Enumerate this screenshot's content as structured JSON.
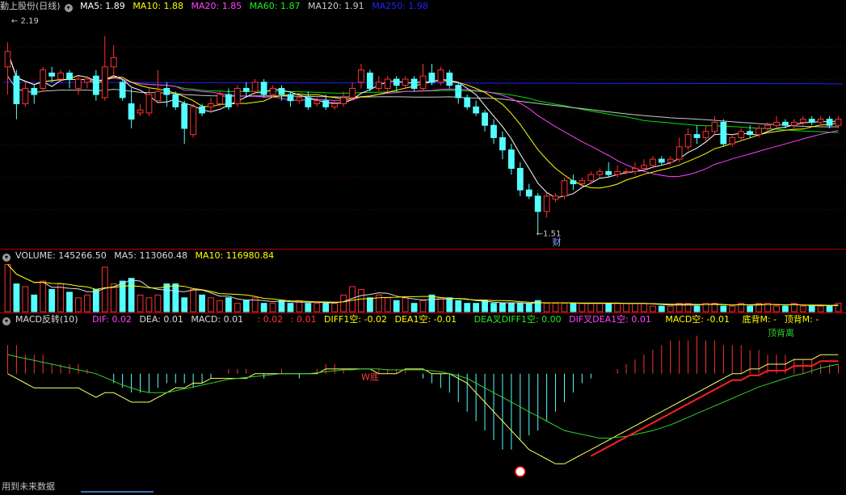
{
  "colors": {
    "bg": "#000000",
    "up": "#ff3232",
    "down": "#54ffff",
    "grid": "#3a0000",
    "sep": "#b00000",
    "ma5": "#ffffff",
    "ma10": "#ffff00",
    "ma20": "#ff40ff",
    "ma60": "#00e000",
    "ma120": "#c8c8c8",
    "ma250": "#2020ff"
  },
  "header_price": {
    "title": "勤上股份(日线)",
    "ma5": "MA5: 1.89",
    "ma10": "MA10: 1.88",
    "ma20": "MA20: 1.85",
    "ma60": "MA60: 1.87",
    "ma120": "MA120: 1.91",
    "ma250": "MA250: 1.98"
  },
  "header_vol": {
    "title": "VOLUME: 145266.50",
    "ma5": "MA5: 113060.48",
    "ma10": "MA10: 116980.84"
  },
  "header_macd": {
    "title": "MACD反转(10)",
    "dif": "DIF: 0.02",
    "dea": "DEA: 0.01",
    "macd": "MACD: 0.01",
    "f1": ": 0.02",
    "f2": ": 0.01",
    "diff1": "DIFF1空: -0.02",
    "dea1": "DEA1空: -0.01",
    "cross1": "DEA叉DIFF1空: 0.00",
    "cross2": "DIF叉DEA1空: 0.01",
    "macd_short": "MACD空: -0.01",
    "bottom": "底背M: -",
    "top": "顶背M: -"
  },
  "footer": {
    "text": "用到未来数据"
  },
  "chart_data": {
    "type": "candlestick",
    "annotations": {
      "high": "2.19",
      "low": "1.51",
      "fin": "财",
      "pattern_w": "W底",
      "top_div": "顶背离"
    },
    "candles": [
      [
        2.05,
        2.1,
        1.96,
        2.13
      ],
      [
        2.02,
        1.93,
        1.88,
        2.04
      ],
      [
        1.93,
        1.98,
        1.92,
        2.0
      ],
      [
        1.98,
        1.96,
        1.93,
        1.99
      ],
      [
        1.98,
        2.04,
        1.97,
        2.05
      ],
      [
        2.03,
        2.02,
        2.0,
        2.05
      ],
      [
        2.01,
        2.03,
        2.0,
        2.04
      ],
      [
        2.03,
        2.01,
        1.98,
        2.04
      ],
      [
        1.98,
        2.01,
        1.96,
        2.02
      ],
      [
        2.0,
        2.01,
        1.98,
        2.02
      ],
      [
        2.02,
        1.96,
        1.94,
        2.04
      ],
      [
        1.95,
        2.05,
        1.94,
        2.15
      ],
      [
        2.05,
        2.08,
        2.02,
        2.12
      ],
      [
        2.0,
        1.95,
        1.94,
        2.01
      ],
      [
        1.93,
        1.88,
        1.85,
        1.98
      ],
      [
        1.9,
        1.91,
        1.89,
        1.93
      ],
      [
        1.9,
        1.96,
        1.89,
        1.98
      ],
      [
        1.94,
        1.97,
        1.94,
        2.04
      ],
      [
        1.98,
        1.96,
        1.92,
        2.0
      ],
      [
        1.96,
        1.92,
        1.91,
        1.97
      ],
      [
        1.93,
        1.85,
        1.8,
        1.94
      ],
      [
        1.83,
        1.92,
        1.82,
        1.93
      ],
      [
        1.92,
        1.9,
        1.89,
        1.93
      ],
      [
        1.92,
        1.93,
        1.9,
        1.95
      ],
      [
        1.93,
        1.96,
        1.92,
        1.97
      ],
      [
        1.96,
        1.92,
        1.91,
        1.98
      ],
      [
        1.93,
        1.98,
        1.92,
        1.99
      ],
      [
        1.98,
        1.97,
        1.95,
        2.0
      ],
      [
        1.97,
        2.0,
        1.96,
        2.01
      ],
      [
        2.0,
        1.96,
        1.95,
        2.01
      ],
      [
        1.96,
        1.98,
        1.95,
        1.99
      ],
      [
        1.98,
        1.96,
        1.94,
        1.99
      ],
      [
        1.96,
        1.94,
        1.92,
        1.97
      ],
      [
        1.94,
        1.95,
        1.93,
        1.96
      ],
      [
        1.95,
        1.92,
        1.91,
        1.97
      ],
      [
        1.93,
        1.94,
        1.92,
        1.95
      ],
      [
        1.94,
        1.92,
        1.91,
        1.96
      ],
      [
        1.92,
        1.93,
        1.91,
        1.94
      ],
      [
        1.93,
        1.95,
        1.92,
        1.97
      ],
      [
        1.95,
        1.98,
        1.94,
        2.0
      ],
      [
        2.0,
        2.04,
        1.98,
        2.06
      ],
      [
        2.03,
        1.98,
        1.97,
        2.04
      ],
      [
        1.98,
        2.0,
        1.97,
        2.02
      ],
      [
        1.98,
        2.01,
        1.97,
        2.02
      ],
      [
        2.01,
        1.99,
        1.97,
        2.02
      ],
      [
        1.99,
        2.01,
        1.98,
        2.02
      ],
      [
        2.01,
        1.98,
        1.97,
        2.02
      ],
      [
        1.98,
        2.02,
        1.97,
        2.06
      ],
      [
        2.03,
        2.0,
        1.99,
        2.06
      ],
      [
        2.0,
        2.04,
        1.99,
        2.05
      ],
      [
        2.03,
        1.99,
        1.98,
        2.04
      ],
      [
        1.99,
        1.95,
        1.93,
        2.0
      ],
      [
        1.95,
        1.92,
        1.91,
        1.96
      ],
      [
        1.92,
        1.9,
        1.89,
        1.94
      ],
      [
        1.9,
        1.86,
        1.84,
        1.91
      ],
      [
        1.86,
        1.82,
        1.8,
        1.88
      ],
      [
        1.82,
        1.78,
        1.75,
        1.84
      ],
      [
        1.78,
        1.72,
        1.7,
        1.8
      ],
      [
        1.72,
        1.65,
        1.63,
        1.74
      ],
      [
        1.65,
        1.63,
        1.62,
        1.67
      ],
      [
        1.63,
        1.58,
        1.51,
        1.64
      ],
      [
        1.58,
        1.63,
        1.56,
        1.64
      ],
      [
        1.62,
        1.63,
        1.61,
        1.64
      ],
      [
        1.63,
        1.68,
        1.62,
        1.69
      ],
      [
        1.68,
        1.67,
        1.65,
        1.7
      ],
      [
        1.67,
        1.68,
        1.66,
        1.69
      ],
      [
        1.68,
        1.7,
        1.67,
        1.71
      ],
      [
        1.7,
        1.71,
        1.69,
        1.72
      ],
      [
        1.71,
        1.7,
        1.69,
        1.74
      ],
      [
        1.7,
        1.71,
        1.69,
        1.73
      ],
      [
        1.71,
        1.71,
        1.7,
        1.72
      ],
      [
        1.71,
        1.72,
        1.7,
        1.74
      ],
      [
        1.72,
        1.73,
        1.71,
        1.75
      ],
      [
        1.73,
        1.75,
        1.72,
        1.76
      ],
      [
        1.75,
        1.74,
        1.73,
        1.76
      ],
      [
        1.74,
        1.75,
        1.73,
        1.76
      ],
      [
        1.75,
        1.79,
        1.74,
        1.82
      ],
      [
        1.79,
        1.83,
        1.78,
        1.85
      ],
      [
        1.83,
        1.82,
        1.8,
        1.86
      ],
      [
        1.82,
        1.84,
        1.81,
        1.86
      ],
      [
        1.84,
        1.87,
        1.83,
        1.89
      ],
      [
        1.87,
        1.8,
        1.79,
        1.88
      ],
      [
        1.8,
        1.82,
        1.79,
        1.83
      ],
      [
        1.82,
        1.84,
        1.81,
        1.85
      ],
      [
        1.84,
        1.83,
        1.82,
        1.86
      ],
      [
        1.83,
        1.85,
        1.82,
        1.86
      ],
      [
        1.85,
        1.86,
        1.84,
        1.87
      ],
      [
        1.86,
        1.87,
        1.85,
        1.89
      ],
      [
        1.87,
        1.86,
        1.85,
        1.88
      ],
      [
        1.86,
        1.87,
        1.85,
        1.88
      ],
      [
        1.87,
        1.88,
        1.86,
        1.89
      ],
      [
        1.88,
        1.87,
        1.86,
        1.89
      ],
      [
        1.87,
        1.88,
        1.86,
        1.89
      ],
      [
        1.88,
        1.86,
        1.85,
        1.89
      ],
      [
        1.86,
        1.88,
        1.85,
        1.89
      ]
    ],
    "volumes": [
      1.7,
      1.0,
      0.9,
      0.6,
      1.1,
      0.8,
      1.0,
      0.7,
      0.5,
      0.6,
      0.8,
      1.6,
      1.0,
      1.1,
      1.2,
      0.6,
      0.5,
      0.6,
      1.0,
      1.0,
      0.5,
      0.8,
      0.6,
      0.5,
      0.4,
      0.5,
      0.3,
      0.4,
      0.5,
      0.3,
      0.3,
      0.4,
      0.3,
      0.4,
      0.3,
      0.3,
      0.3,
      0.3,
      0.6,
      0.9,
      0.8,
      0.5,
      0.6,
      0.5,
      0.4,
      0.5,
      0.3,
      0.4,
      0.6,
      0.5,
      0.5,
      0.4,
      0.3,
      0.3,
      0.4,
      0.3,
      0.3,
      0.3,
      0.3,
      0.3,
      0.4,
      0.3,
      0.3,
      0.3,
      0.3,
      0.3,
      0.3,
      0.3,
      0.3,
      0.3,
      0.3,
      0.3,
      0.3,
      0.2,
      0.2,
      0.2,
      0.3,
      0.3,
      0.2,
      0.3,
      0.3,
      0.2,
      0.2,
      0.3,
      0.2,
      0.3,
      0.3,
      0.2,
      0.2,
      0.3,
      0.2,
      0.2,
      0.2,
      0.2,
      0.3
    ],
    "price_range": [
      1.48,
      2.22
    ],
    "ma250": 2.0,
    "macd_range": [
      -0.11,
      0.05
    ],
    "macd_hist": [
      0.03,
      0.03,
      0.02,
      0.02,
      0.02,
      0.01,
      0.01,
      0.01,
      0.01,
      0.005,
      0.0,
      0.0,
      -0.01,
      -0.015,
      -0.02,
      -0.02,
      -0.02,
      -0.015,
      -0.01,
      -0.01,
      -0.01,
      -0.015,
      -0.01,
      -0.005,
      0.0,
      0.005,
      0.005,
      0.005,
      0.0,
      -0.005,
      0.0,
      0.005,
      0.0,
      -0.005,
      0.0,
      0.005,
      0.01,
      0.01,
      0.005,
      0.0,
      0.0,
      0.0,
      0.005,
      0.005,
      0.005,
      0.005,
      0.0,
      -0.005,
      -0.01,
      -0.015,
      -0.02,
      -0.03,
      -0.04,
      -0.05,
      -0.06,
      -0.07,
      -0.08,
      -0.08,
      -0.07,
      -0.065,
      -0.06,
      -0.05,
      -0.04,
      -0.03,
      -0.02,
      -0.01,
      -0.005,
      0.0,
      0.0,
      0.005,
      0.01,
      0.015,
      0.02,
      0.025,
      0.03,
      0.035,
      0.035,
      0.035,
      0.04,
      0.035,
      0.035,
      0.03,
      0.03,
      0.03,
      0.025,
      0.025,
      0.02,
      0.02,
      0.02,
      0.015,
      0.015,
      0.015,
      0.01,
      0.01,
      0.01
    ],
    "dif": [
      0.0,
      -0.005,
      -0.01,
      -0.015,
      -0.015,
      -0.015,
      -0.015,
      -0.015,
      -0.015,
      -0.02,
      -0.025,
      -0.02,
      -0.02,
      -0.025,
      -0.03,
      -0.03,
      -0.03,
      -0.025,
      -0.02,
      -0.015,
      -0.015,
      -0.01,
      -0.01,
      -0.005,
      -0.005,
      -0.005,
      -0.005,
      -0.005,
      0.0,
      0.0,
      0.0,
      0.0,
      0.0,
      0.0,
      0.0,
      0.0,
      0.005,
      0.005,
      0.005,
      0.005,
      0.005,
      0.005,
      0.0,
      0.0,
      0.0,
      0.005,
      0.005,
      0.005,
      0.0,
      0.0,
      0.0,
      -0.005,
      -0.01,
      -0.02,
      -0.03,
      -0.04,
      -0.05,
      -0.06,
      -0.07,
      -0.08,
      -0.085,
      -0.09,
      -0.095,
      -0.095,
      -0.09,
      -0.085,
      -0.08,
      -0.075,
      -0.07,
      -0.065,
      -0.06,
      -0.055,
      -0.05,
      -0.045,
      -0.04,
      -0.035,
      -0.03,
      -0.025,
      -0.02,
      -0.015,
      -0.01,
      -0.005,
      0.0,
      0.0,
      0.005,
      0.005,
      0.01,
      0.01,
      0.01,
      0.015,
      0.015,
      0.015,
      0.02,
      0.02,
      0.02
    ],
    "dea": [
      0.02,
      0.018,
      0.016,
      0.014,
      0.012,
      0.01,
      0.008,
      0.006,
      0.004,
      0.002,
      0.0,
      -0.004,
      -0.008,
      -0.012,
      -0.015,
      -0.018,
      -0.02,
      -0.02,
      -0.02,
      -0.018,
      -0.016,
      -0.014,
      -0.012,
      -0.01,
      -0.008,
      -0.006,
      -0.005,
      -0.004,
      -0.003,
      -0.002,
      -0.001,
      0.0,
      0.0,
      0.0,
      0.0,
      0.001,
      0.002,
      0.003,
      0.004,
      0.004,
      0.005,
      0.005,
      0.005,
      0.004,
      0.004,
      0.004,
      0.004,
      0.004,
      0.003,
      0.002,
      0.0,
      -0.002,
      -0.005,
      -0.01,
      -0.015,
      -0.02,
      -0.025,
      -0.03,
      -0.035,
      -0.04,
      -0.045,
      -0.05,
      -0.055,
      -0.06,
      -0.062,
      -0.064,
      -0.066,
      -0.068,
      -0.068,
      -0.067,
      -0.066,
      -0.064,
      -0.062,
      -0.06,
      -0.057,
      -0.054,
      -0.05,
      -0.046,
      -0.042,
      -0.038,
      -0.034,
      -0.03,
      -0.026,
      -0.022,
      -0.018,
      -0.014,
      -0.011,
      -0.008,
      -0.005,
      -0.002,
      0.0,
      0.003,
      0.006,
      0.008,
      0.01
    ]
  }
}
